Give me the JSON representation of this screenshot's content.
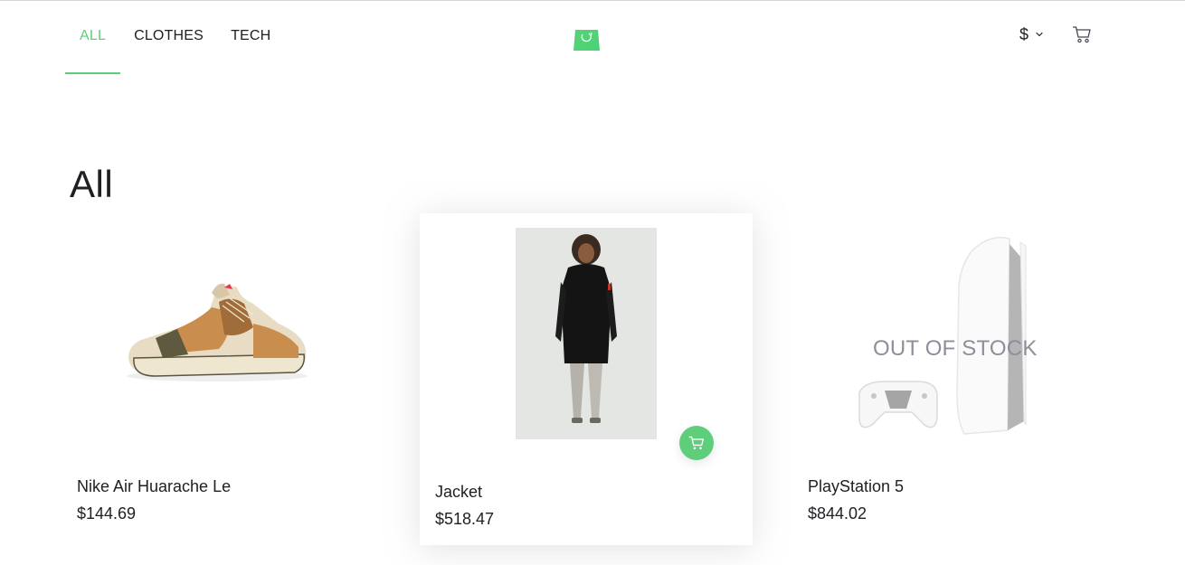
{
  "nav": {
    "items": [
      {
        "label": "ALL",
        "active": true
      },
      {
        "label": "CLOTHES",
        "active": false
      },
      {
        "label": "TECH",
        "active": false
      }
    ]
  },
  "header": {
    "logo_icon": "shopping-bag-refresh-icon",
    "currency_symbol": "$",
    "currency_icon": "chevron-down-icon",
    "cart_icon": "cart-icon"
  },
  "category": {
    "title": "All"
  },
  "products": [
    {
      "name": "Nike Air Huarache Le",
      "price": "$144.69",
      "in_stock": true,
      "image_icon": "sneaker-image"
    },
    {
      "name": "Jacket",
      "price": "$518.47",
      "in_stock": true,
      "image_icon": "jacket-model-image",
      "add_to_cart_icon": "cart-icon"
    },
    {
      "name": "PlayStation 5",
      "price": "$844.02",
      "in_stock": false,
      "out_of_stock_label": "OUT OF STOCK",
      "image_icon": "console-image"
    }
  ],
  "colors": {
    "accent": "#5ece7b",
    "text": "#1d1f22",
    "muted": "#8d8f9a"
  }
}
